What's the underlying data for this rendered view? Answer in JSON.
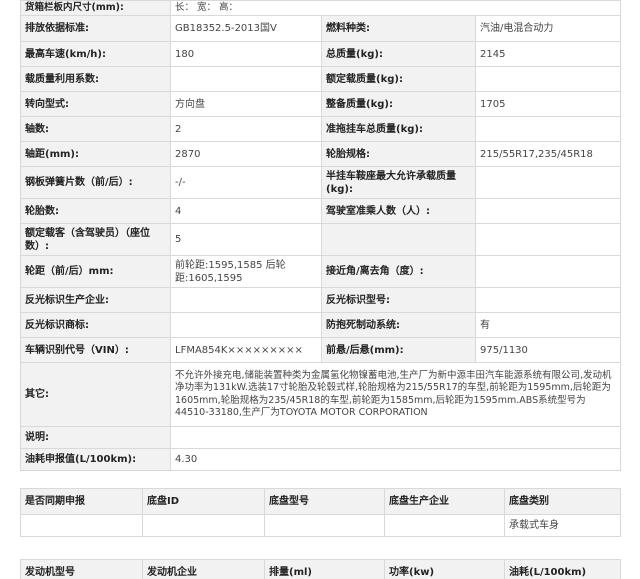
{
  "spec": {
    "top_row": {
      "label": "货箱栏板内尺寸(mm):",
      "value": "长：  宽：  高："
    },
    "rows": [
      [
        {
          "label": "排放依据标准:",
          "value": "GB18352.5-2013国Ⅴ"
        },
        {
          "label": "燃料种类:",
          "value": "汽油/电混合动力"
        }
      ],
      [
        {
          "label": "最高车速(km/h):",
          "value": "180"
        },
        {
          "label": "总质量(kg):",
          "value": "2145"
        }
      ],
      [
        {
          "label": "载质量利用系数:",
          "value": ""
        },
        {
          "label": "额定载质量(kg):",
          "value": ""
        }
      ],
      [
        {
          "label": "转向型式:",
          "value": "方向盘"
        },
        {
          "label": "整备质量(kg):",
          "value": "1705"
        }
      ],
      [
        {
          "label": "轴数:",
          "value": "2"
        },
        {
          "label": "准拖挂车总质量(kg):",
          "value": ""
        }
      ],
      [
        {
          "label": "轴距(mm):",
          "value": "2870"
        },
        {
          "label": "轮胎规格:",
          "value": "215/55R17,235/45R18"
        }
      ],
      [
        {
          "label": "钢板弹簧片数（前/后）:",
          "value": "-/-"
        },
        {
          "label": "半挂车鞍座最大允许承载质量(kg):",
          "value": ""
        }
      ],
      [
        {
          "label": "轮胎数:",
          "value": "4"
        },
        {
          "label": "驾驶室准乘人数（人）:",
          "value": ""
        }
      ],
      [
        {
          "label": "额定载客（含驾驶员）（座位数）:",
          "value": "5"
        },
        {
          "label": "",
          "value": ""
        }
      ],
      [
        {
          "label": "轮距（前/后）mm:",
          "value": "前轮距:1595,1585 后轮距:1605,1595"
        },
        {
          "label": "接近角/离去角（度）:",
          "value": ""
        }
      ],
      [
        {
          "label": "反光标识生产企业:",
          "value": ""
        },
        {
          "label": "反光标识型号:",
          "value": ""
        }
      ],
      [
        {
          "label": "反光标识商标:",
          "value": ""
        },
        {
          "label": "防抱死制动系统:",
          "value": "有"
        }
      ],
      [
        {
          "label": "车辆识别代号（VIN）:",
          "value": "LFMA854K×××××××××"
        },
        {
          "label": "前悬/后悬(mm):",
          "value": "975/1130"
        }
      ]
    ],
    "other": {
      "label": "其它:",
      "value": "不允许外接充电,储能装置种类为金属氢化物镍蓄电池,生产厂为新中源丰田汽车能源系统有限公司,发动机净功率为131kW.选装17寸轮胎及轮毂式样,轮胎规格为215/55R17的车型,前轮距为1595mm,后轮距为1605mm,轮胎规格为235/45R18的车型,前轮距为1585mm,后轮距为1595mm.ABS系统型号为44510-33180,生产厂为TOYOTA MOTOR CORPORATION"
    },
    "note": {
      "label": "说明:",
      "value": ""
    },
    "fuel": {
      "label": "油耗申报值(L/100km):",
      "value": "4.30"
    }
  },
  "chassis": {
    "headers": [
      "是否同期申报",
      "底盘ID",
      "底盘型号",
      "底盘生产企业",
      "底盘类别"
    ],
    "row": [
      "",
      "",
      "",
      "",
      "承载式车身"
    ]
  },
  "engine": {
    "headers": [
      "发动机型号",
      "发动机企业",
      "排量(ml)",
      "功率(kw)",
      "油耗(L/100km)"
    ]
  }
}
